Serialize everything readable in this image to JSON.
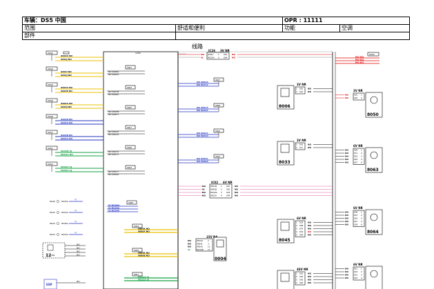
{
  "header": {
    "row1": {
      "label": "车辆：DS5 中国",
      "opr": "OPR : 11111"
    },
    "row2": {
      "scope": "范围",
      "category": "舒适和便利",
      "function": "功能",
      "value": "空调"
    },
    "row3": {
      "part": "部件"
    }
  },
  "diagram_title": "线路",
  "left_connectors": [
    {
      "code": "0002",
      "wires": [
        "9A02A NO",
        "9A02J NO"
      ],
      "wire_color": "#e8c000"
    },
    {
      "code": "0004",
      "wires": [
        "9A02I NO",
        "9A02J NO"
      ],
      "wire_color": "#e8c000"
    },
    {
      "code": "0005",
      "wires": [
        "9A03A NO",
        "9A03E NO"
      ],
      "wire_color": "#e8c000"
    },
    {
      "code": "0006",
      "wires": [
        "9A02A NO",
        "9A02J NO"
      ],
      "wire_color": "#e8c000"
    },
    {
      "code": "0008",
      "wires": [
        "9A03B NO",
        "9A03A NO"
      ],
      "wire_color": "#2030c0"
    },
    {
      "code": "0007",
      "wires": [
        "9A03B NO",
        "9A03A NO"
      ],
      "wire_color": "#2030c0"
    },
    {
      "code": "0001",
      "wires": [
        "MC05B VJ",
        "MC04A NO"
      ],
      "wire_color": "#10a040"
    },
    {
      "code": "0003",
      "wires": [
        "MC06A VJ",
        "MC06A VJ"
      ],
      "wire_color": "#10a040"
    }
  ],
  "left_small_labels": [
    {
      "code": "MC06",
      "ref": "MC05A",
      "tag": "VJ"
    },
    {
      "code": "MC05",
      "ref": "MC04A",
      "tag": "VJ"
    },
    {
      "code": "MC04",
      "ref": "MC06A",
      "tag": "VJ"
    },
    {
      "code": "MC03",
      "ref": "MC03A",
      "tag": "VJ"
    }
  ],
  "mid_wires": [
    {
      "top": "NO 9008A",
      "bottom": "NO 9005A",
      "code": "0001"
    },
    {
      "top": "NO 9007B",
      "bottom": "NO 9006A",
      "code": "0002"
    },
    {
      "top": "NO 9005B",
      "bottom": "NO 9005T",
      "code": "0005"
    },
    {
      "top": "NO 9001E",
      "bottom": "NO 9001A",
      "code": "0007"
    },
    {
      "top": "NO 9001V",
      "bottom": "NO 9001T",
      "code": "0006"
    },
    {
      "top": "NO 9001T",
      "bottom": "NO 9005K",
      "code": "0002"
    }
  ],
  "mc_group": {
    "code": "0060",
    "wires": [
      "VJ MC06A",
      "VJ MC05A",
      "VJ MC04A"
    ]
  },
  "center_links": [
    {
      "top": "NO 9005A",
      "bottom": "NO 9011C",
      "code": "0007"
    },
    {
      "top": "NO 9001A",
      "bottom": "NO 9016C",
      "code": "0008"
    },
    {
      "top": "NO 9024C",
      "bottom": "NO 9024A",
      "code": "0004"
    },
    {
      "top": "NO 9025C",
      "bottom": "NO 9020A",
      "code": "0003"
    }
  ],
  "ic26": {
    "name": "IC26",
    "voltage": "3V NR",
    "left": [
      "NO",
      "VJ"
    ],
    "rows": [
      [
        "J010A",
        "1",
        "001"
      ],
      [
        "MC05A",
        "4",
        "004"
      ]
    ],
    "right": [
      "NO",
      "NO"
    ]
  },
  "ic02": {
    "name": "IC02",
    "voltage": "6V NR",
    "left": [
      "NO",
      "VJ",
      "NO",
      "NO"
    ],
    "rows": [
      [
        "ZE21B",
        "1",
        "001"
      ],
      [
        "9005B",
        "2",
        "002"
      ],
      [
        "MC06A",
        "3",
        "003"
      ],
      [
        "9002A",
        "4",
        "004"
      ]
    ],
    "right": [
      "NO",
      "NO",
      "NO",
      "NO"
    ]
  },
  "box0004": {
    "name": "0004",
    "voltage": "15V BA",
    "left": [
      "NO",
      "NO",
      "NO",
      "VJ"
    ],
    "rows": [
      [
        "ZE16A",
        "2"
      ],
      [
        "9004L",
        "3"
      ],
      [
        "9005A",
        "11"
      ],
      [
        "MC04B",
        "13"
      ]
    ]
  },
  "lower_bars": [
    {
      "code": "0006",
      "wires": [
        "9005K NO",
        "9006A NO"
      ]
    },
    {
      "code": "0006",
      "wires": [
        "9005K NO",
        "9006B NO"
      ]
    },
    {
      "code": "0001",
      "wires": [
        "MC05A VJ",
        "MC02A VJ"
      ]
    }
  ],
  "comp_12": {
    "label": "12--",
    "wires": [
      "NO",
      "NO",
      "NO",
      "NO"
    ]
  },
  "comp_esp": {
    "label": "ESP"
  },
  "components": [
    {
      "name": "8006",
      "voltage": "2V NR",
      "rows": [
        [
          "1",
          "001"
        ],
        [
          "2",
          "010"
        ]
      ],
      "right": [
        "NO",
        "NO"
      ]
    },
    {
      "name": "8033",
      "voltage": "2V NR",
      "rows": [
        [
          "1",
          "001"
        ],
        [
          "2",
          "011"
        ]
      ],
      "right": [
        "NO",
        "NO"
      ]
    },
    {
      "name": "8045",
      "voltage": "6V NR",
      "rows": [
        [
          "1",
          "001"
        ],
        [
          "2",
          "008"
        ],
        [
          "3",
          "007"
        ],
        [
          "4",
          "003"
        ],
        [
          "5",
          "004"
        ]
      ],
      "right": [
        "NO",
        "NO",
        "NO",
        "NO",
        "NO"
      ]
    },
    {
      "name": "",
      "voltage": "4SV NR",
      "rows": [
        [
          "1",
          "001"
        ],
        [
          "2",
          "002"
        ],
        [
          "3",
          "003"
        ],
        [
          "4",
          "005"
        ]
      ],
      "right": [
        "NO",
        "NO",
        "NO",
        "NO"
      ]
    }
  ],
  "right_top_box": {
    "code": "0002",
    "wires": [
      "NO 002",
      "NO 002",
      "NO 001"
    ]
  },
  "right_components": [
    {
      "name": "8050",
      "voltage": "2V NR",
      "left": [
        "NO",
        "NO"
      ],
      "rows": [
        [
          "001",
          "1"
        ],
        [
          "002",
          "2"
        ]
      ]
    },
    {
      "name": "8063",
      "voltage": "6V NR",
      "left": [
        "NO",
        "NO",
        "NO",
        "NO",
        "NO"
      ],
      "rows": [
        [
          "009",
          "1"
        ],
        [
          "011",
          "2"
        ],
        [
          "025",
          "3"
        ],
        [
          "026",
          "4"
        ],
        [
          "027",
          "6"
        ]
      ]
    },
    {
      "name": "8064",
      "voltage": "6V NR",
      "left": [
        "NO",
        "NO",
        "NO",
        "NO",
        "NO"
      ],
      "rows": [
        [
          "008",
          "1"
        ],
        [
          "015",
          "2"
        ],
        [
          "026",
          "3"
        ],
        [
          "027",
          "4"
        ],
        [
          "028",
          "6"
        ]
      ]
    },
    {
      "name": "",
      "voltage": "6V NR",
      "left": [
        "NO",
        "NO",
        "NO",
        "NO"
      ],
      "rows": [
        [
          "011",
          "1"
        ],
        [
          "016",
          "2"
        ],
        [
          "021",
          "3"
        ],
        [
          "022",
          "4"
        ]
      ]
    }
  ],
  "colors": {
    "yellow": "#e8c000",
    "blue": "#2030c0",
    "green": "#10a040",
    "red": "#e00000",
    "pink": "#e060a0",
    "grey": "#909090"
  }
}
